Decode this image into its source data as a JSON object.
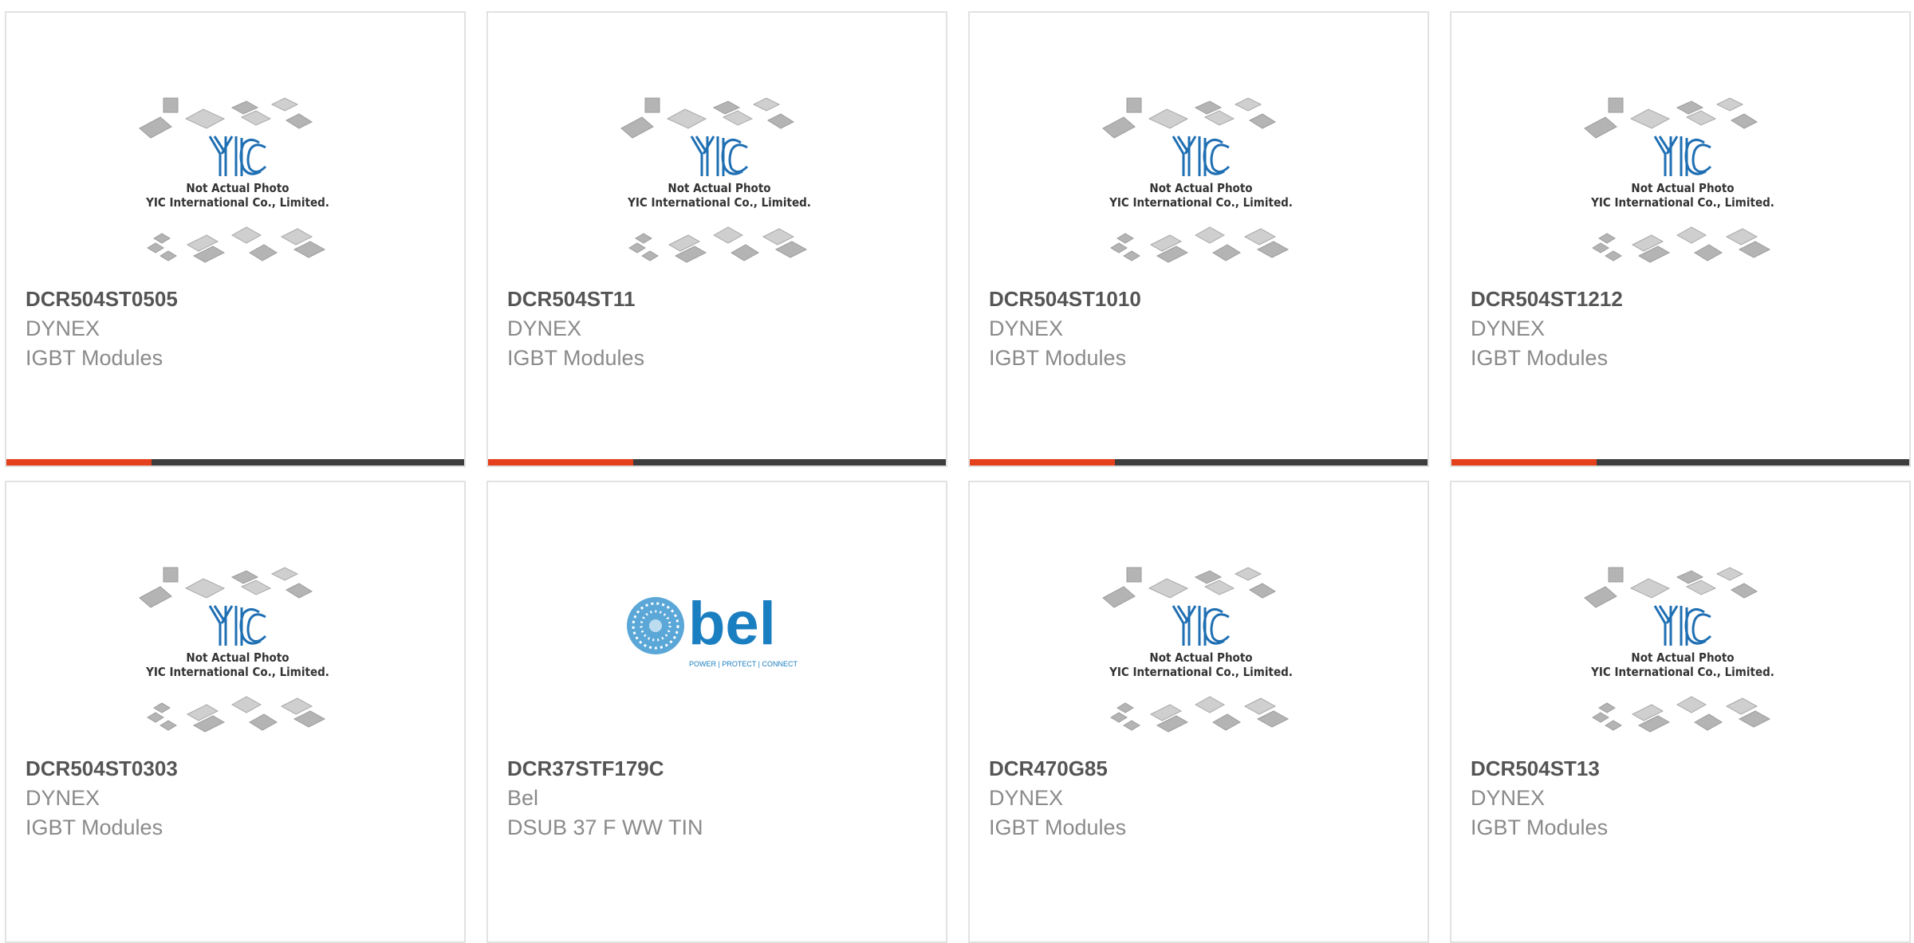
{
  "products": [
    {
      "part_number": "DCR504ST0505",
      "manufacturer": "DYNEX",
      "category": "IGBT Modules",
      "image": "yic-placeholder",
      "note_line1": "Not Actual Photo",
      "note_line2": "YIC International Co., Limited."
    },
    {
      "part_number": "DCR504ST11",
      "manufacturer": "DYNEX",
      "category": "IGBT Modules",
      "image": "yic-placeholder",
      "note_line1": "Not Actual Photo",
      "note_line2": "YIC International Co., Limited."
    },
    {
      "part_number": "DCR504ST1010",
      "manufacturer": "DYNEX",
      "category": "IGBT Modules",
      "image": "yic-placeholder",
      "note_line1": "Not Actual Photo",
      "note_line2": "YIC International Co., Limited."
    },
    {
      "part_number": "DCR504ST1212",
      "manufacturer": "DYNEX",
      "category": "IGBT Modules",
      "image": "yic-placeholder",
      "note_line1": "Not Actual Photo",
      "note_line2": "YIC International Co., Limited."
    },
    {
      "part_number": "DCR504ST0303",
      "manufacturer": "DYNEX",
      "category": "IGBT Modules",
      "image": "yic-placeholder",
      "note_line1": "Not Actual Photo",
      "note_line2": "YIC International Co., Limited."
    },
    {
      "part_number": "DCR37STF179C",
      "manufacturer": "Bel",
      "category": "DSUB 37 F WW TIN",
      "image": "bel-logo",
      "logo_text": "bel",
      "logo_tagline": "POWER | PROTECT | CONNECT"
    },
    {
      "part_number": "DCR470G85",
      "manufacturer": "DYNEX",
      "category": "IGBT Modules",
      "image": "yic-placeholder",
      "note_line1": "Not Actual Photo",
      "note_line2": "YIC International Co., Limited."
    },
    {
      "part_number": "DCR504ST13",
      "manufacturer": "DYNEX",
      "category": "IGBT Modules",
      "image": "yic-placeholder",
      "note_line1": "Not Actual Photo",
      "note_line2": "YIC International Co., Limited."
    }
  ],
  "colors": {
    "accent": "#e4401c",
    "bar": "#3d3d3d",
    "yic_blue": "#1f6fb3",
    "bel_blue": "#1a7fc1"
  }
}
